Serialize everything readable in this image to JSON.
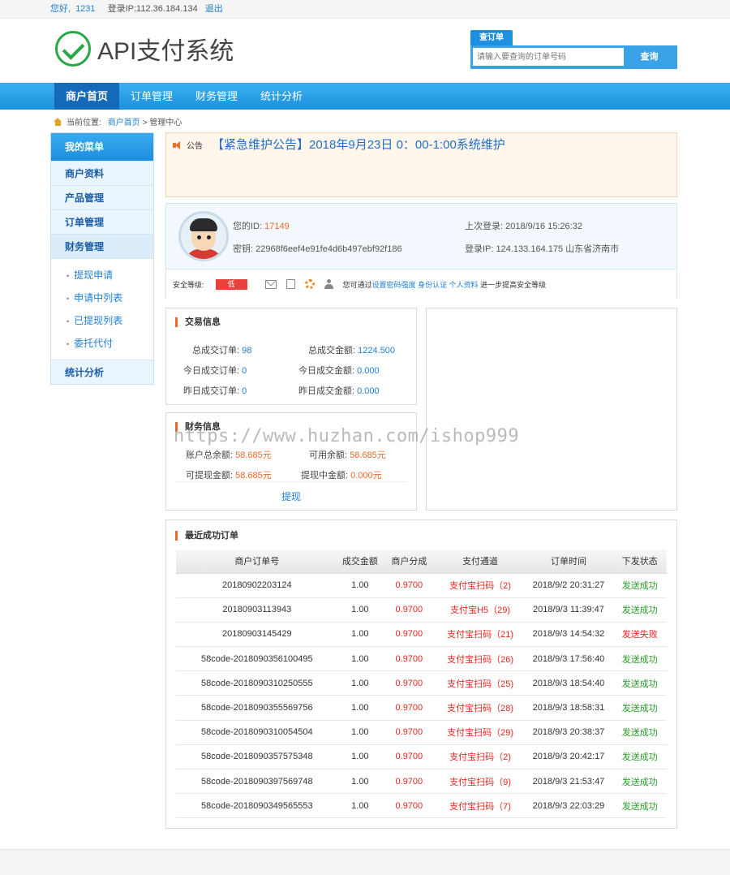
{
  "topbar": {
    "greeting": "您好,",
    "username": "1231",
    "login_ip": "登录IP:112.36.184.134",
    "logout": "退出"
  },
  "header": {
    "logo_text": "API支付系统"
  },
  "search": {
    "tab": "查订单",
    "placeholder": "请输入要查询的订单号码",
    "button": "查询"
  },
  "nav": [
    {
      "label": "商户首页",
      "active": true
    },
    {
      "label": "订单管理"
    },
    {
      "label": "财务管理"
    },
    {
      "label": "统计分析"
    }
  ],
  "breadcrumb": {
    "prefix": "当前位置:",
    "home": "商户首页",
    "current": "> 管理中心"
  },
  "sidebar": {
    "title": "我的菜单",
    "items": [
      "商户资料",
      "产品管理",
      "订单管理",
      "财务管理"
    ],
    "sub_items": [
      "提现申请",
      "申请中列表",
      "已提现列表",
      "委托代付"
    ],
    "last_item": "统计分析"
  },
  "notice": {
    "label": "公告",
    "title": "【紧急维护公告】2018年9月23日 0：00-1:00系统维护"
  },
  "user": {
    "id_label": "您的ID:",
    "id_value": "17149",
    "key_label": "密钥:",
    "key_value": "22968f6eef4e91fe4d6b497ebf92f186",
    "last_login_label": "上次登录:",
    "last_login_value": "2018/9/16 15:26:32",
    "login_ip_label": "登录IP:",
    "login_ip_value": "124.133.164.175  山东省济南市"
  },
  "security": {
    "label": "安全等级:",
    "level": "低",
    "tip_prefix": "您可通过",
    "link1": "设置密码强度",
    "link2": "身份认证",
    "link3": "个人资料",
    "tip_suffix": "进一步提高安全等级"
  },
  "trade": {
    "title": "交易信息",
    "total_orders_label": "总成交订单:",
    "total_orders": "98",
    "total_amount_label": "总成交金额:",
    "total_amount": "1224.500",
    "today_orders_label": "今日成交订单:",
    "today_orders": "0",
    "today_amount_label": "今日成交金额:",
    "today_amount": "0.000",
    "yesterday_orders_label": "昨日成交订单:",
    "yesterday_orders": "0",
    "yesterday_amount_label": "昨日成交金额:",
    "yesterday_amount": "0.000"
  },
  "finance": {
    "title": "财务信息",
    "balance_label": "账户总余额:",
    "balance": "58.685元",
    "available_label": "可用余额:",
    "available": "58.685元",
    "withdrawable_label": "可提现金额:",
    "withdrawable": "58.685元",
    "pending_label": "提现中金额:",
    "pending": "0.000元",
    "withdraw_link": "提现"
  },
  "watermark": "https://www.huzhan.com/ishop999",
  "orders": {
    "title": "最近成功订单",
    "headers": [
      "商户订单号",
      "成交金额",
      "商户分成",
      "支付通道",
      "订单时间",
      "下发状态"
    ],
    "rows": [
      [
        "20180902203124",
        "1.00",
        "0.9700",
        "支付宝扫码（2)",
        "2018/9/2 20:31:27",
        "发送成功"
      ],
      [
        "20180903113943",
        "1.00",
        "0.9700",
        "支付宝H5（29)",
        "2018/9/3 11:39:47",
        "发送成功"
      ],
      [
        "20180903145429",
        "1.00",
        "0.9700",
        "支付宝扫码（21)",
        "2018/9/3 14:54:32",
        "发送失败"
      ],
      [
        "58code-2018090356100495",
        "1.00",
        "0.9700",
        "支付宝扫码（26)",
        "2018/9/3 17:56:40",
        "发送成功"
      ],
      [
        "58code-2018090310250555",
        "1.00",
        "0.9700",
        "支付宝扫码（25)",
        "2018/9/3 18:54:40",
        "发送成功"
      ],
      [
        "58code-2018090355569756",
        "1.00",
        "0.9700",
        "支付宝扫码（28)",
        "2018/9/3 18:58:31",
        "发送成功"
      ],
      [
        "58code-2018090310054504",
        "1.00",
        "0.9700",
        "支付宝扫码（29)",
        "2018/9/3 20:38:37",
        "发送成功"
      ],
      [
        "58code-2018090357575348",
        "1.00",
        "0.9700",
        "支付宝扫码（2)",
        "2018/9/3 20:42:17",
        "发送成功"
      ],
      [
        "58code-2018090397569748",
        "1.00",
        "0.9700",
        "支付宝扫码（9)",
        "2018/9/3 21:53:47",
        "发送成功"
      ],
      [
        "58code-2018090349565553",
        "1.00",
        "0.9700",
        "支付宝扫码（7)",
        "2018/9/3 22:03:29",
        "发送成功"
      ]
    ]
  },
  "colors": {
    "accent": "#1d90dc",
    "nav_active": "#1469b8",
    "danger": "#e8251f",
    "success": "#2a9c2a",
    "orange": "#f0692b"
  }
}
